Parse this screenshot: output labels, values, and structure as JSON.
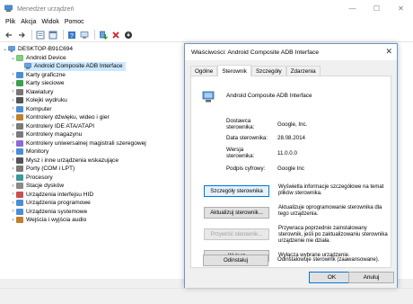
{
  "window": {
    "title": "Menedżer urządzeń",
    "controls": [
      "—",
      "☐",
      "✕"
    ]
  },
  "menu": [
    "Plik",
    "Akcja",
    "Widok",
    "Pomoc"
  ],
  "tree": {
    "root": "DESKTOP-B91C694",
    "expanded_category": "Android Device",
    "selected_child": "Android Composite ADB Interface",
    "categories": [
      "Karty graficzne",
      "Karty sieciowe",
      "Klawiatury",
      "Kolejki wydruku",
      "Komputer",
      "Kontrolery dźwięku, wideo i gier",
      "Kontrolery IDE ATA/ATAPI",
      "Kontrolery magazynu",
      "Kontrolery uniwersalnej magistrali szeregowej",
      "Monitory",
      "Mysz i inne urządzenia wskazujące",
      "Porty (COM i LPT)",
      "Procesory",
      "Stacje dysków",
      "Urządzenia interfejsu HID",
      "Urządzenia programowe",
      "Urządzenia systemowe",
      "Wejścia i wyjścia audio"
    ]
  },
  "dialog": {
    "title": "Właściwości: Android Composite ADB Interface",
    "tabs": [
      "Ogólne",
      "Sterownik",
      "Szczegóły",
      "Zdarzenia"
    ],
    "active_tab": "Sterownik",
    "device_name": "Android Composite ADB Interface",
    "props": {
      "provider_label": "Dostawca sterownika:",
      "provider_value": "Google, Inc.",
      "date_label": "Data sterownika:",
      "date_value": "28.08.2014",
      "version_label": "Wersja sterownika:",
      "version_value": "11.0.0.0",
      "signer_label": "Podpis cyfrowy:",
      "signer_value": "Google Inc"
    },
    "actions": [
      {
        "label": "Szczegóły sterownika",
        "desc": "Wyświetla informacje szczegółowe na temat plików sterownika."
      },
      {
        "label": "Aktualizuj sterownik...",
        "desc": "Aktualizuje oprogramowanie sterownika dla tego urządzenia."
      },
      {
        "label": "Przywróć sterownik...",
        "desc": "Przywraca poprzednio zainstalowany sterownik, jeśli po zaktualizowaniu sterownika urządzenie nie działa."
      },
      {
        "label": "Wyłącz",
        "desc": "Wyłącza wybrane urządzenie."
      },
      {
        "label": "Odinstaluj",
        "desc": "Odinstalowuje sterownik (zaawansowane)."
      }
    ],
    "ok_label": "OK",
    "cancel_label": "Anuluj",
    "close_glyph": "✕"
  },
  "colors": {
    "accent": "#0078d7",
    "selection": "#cce8ff",
    "folder": "#3c8fd6"
  }
}
